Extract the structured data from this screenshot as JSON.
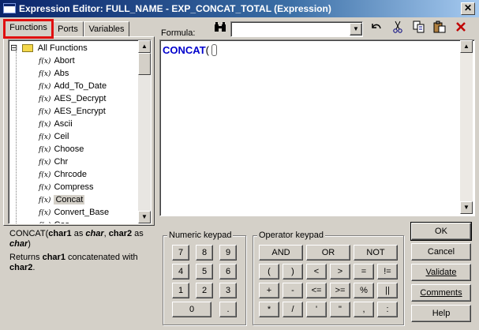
{
  "window": {
    "title": "Expression Editor: FULL_NAME - EXP_CONCAT_TOTAL (Expression)",
    "close_glyph": "✕"
  },
  "tabs": [
    {
      "label": "Functions",
      "active": true
    },
    {
      "label": "Ports",
      "active": false
    },
    {
      "label": "Variables",
      "active": false
    }
  ],
  "tree": {
    "root_label": "All Functions",
    "expander": "⊟",
    "fx_prefix": "f(x)",
    "items": [
      "Abort",
      "Abs",
      "Add_To_Date",
      "AES_Decrypt",
      "AES_Encrypt",
      "Ascii",
      "Ceil",
      "Choose",
      "Chr",
      "Chrcode",
      "Compress",
      "Concat",
      "Convert_Base",
      "Cos"
    ],
    "selected": "Concat"
  },
  "description": {
    "signature_parts": [
      {
        "text": "CONCAT(",
        "style": "normal"
      },
      {
        "text": "char1",
        "style": "bold"
      },
      {
        "text": " as ",
        "style": "normal"
      },
      {
        "text": "char",
        "style": "bolditalic"
      },
      {
        "text": ", ",
        "style": "normal"
      },
      {
        "text": "char2",
        "style": "bold"
      },
      {
        "text": " as ",
        "style": "normal"
      },
      {
        "text": "char",
        "style": "bolditalic"
      },
      {
        "text": ")",
        "style": "normal"
      }
    ],
    "returns_parts": [
      {
        "text": "Returns ",
        "style": "normal"
      },
      {
        "text": "char1",
        "style": "bold"
      },
      {
        "text": " concatenated with ",
        "style": "normal"
      },
      {
        "text": "char2",
        "style": "bold"
      },
      {
        "text": ".",
        "style": "normal"
      }
    ]
  },
  "formula": {
    "label": "Formula:",
    "text": "CONCAT",
    "paren": "(",
    "search_value": ""
  },
  "toolbar_icons": [
    "binoculars-icon",
    "undo-icon",
    "cut-icon",
    "copy-icon",
    "paste-icon",
    "delete-icon"
  ],
  "numeric_keypad": {
    "title": "Numeric keypad",
    "rows": [
      [
        "7",
        "8",
        "9"
      ],
      [
        "4",
        "5",
        "6"
      ],
      [
        "1",
        "2",
        "3"
      ],
      [
        "0",
        "."
      ]
    ]
  },
  "operator_keypad": {
    "title": "Operator keypad",
    "row1": [
      "AND",
      "OR",
      "NOT"
    ],
    "rows": [
      [
        "(",
        ")",
        "<",
        ">",
        "=",
        "!="
      ],
      [
        "+",
        "-",
        "<=",
        ">=",
        "%",
        "||"
      ],
      [
        "*",
        "/",
        "'",
        "\"",
        ",",
        ":"
      ]
    ]
  },
  "buttons": {
    "ok": "OK",
    "cancel": "Cancel",
    "validate": "Validate",
    "comments": "Comments",
    "help": "Help"
  }
}
